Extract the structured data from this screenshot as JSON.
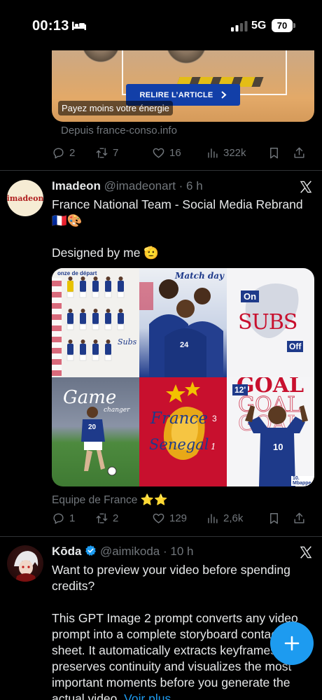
{
  "status_bar": {
    "time": "00:13",
    "network": "5G",
    "battery": "70"
  },
  "tweet_prev": {
    "ad_button": "RELIRE L’ARTICLE",
    "ad_caption": "Payez moins votre énergie",
    "source": "Depuis france-conso.info",
    "replies": "2",
    "reposts": "7",
    "likes": "16",
    "views": "322k"
  },
  "tweet1": {
    "avatar_text": "imadeon",
    "name": "Imadeon",
    "handle_time": "@imadeonart · 6 h",
    "line1": "France National Team - Social Media Rebrand",
    "emoji_line": "🇫🇷🎨",
    "line2": "Designed by me 🫡",
    "grid": {
      "c1_title": "onze de départ",
      "c1_label": "Subs",
      "c2_label": "Match day",
      "c2_number": "24",
      "c3_on": "On",
      "c3_title": "SUBS",
      "c3_off": "Off",
      "c4_title": "Game",
      "c4_sub": "changer",
      "c4_number": "20",
      "c5_title": "France",
      "c5_score1": "3",
      "c5_team2": "Senegal",
      "c5_score2": "1",
      "c6_title": "GOAL",
      "c6_number": "12'",
      "c6_shirt": "10",
      "c6_name": "10. Mbappe"
    },
    "footer_label": "Equipe de France ⭐⭐",
    "replies": "1",
    "reposts": "2",
    "likes": "129",
    "views": "2,6k"
  },
  "tweet2": {
    "name": "Kōda",
    "handle_time": "@aimikoda · 10 h",
    "para1": "Want to preview your video before spending credits?",
    "para2": "This GPT Image 2 prompt converts any video prompt into a complete storyboard contact sheet. It automatically extracts keyframes, preserves continuity and visualizes the most important moments before you generate the actual video.",
    "more_link": "Voir plus"
  },
  "colors": {
    "accent": "#1d9bf0",
    "muted": "#71767b",
    "france_blue": "#1e3a8a",
    "france_red": "#c8102e"
  },
  "icons": [
    "reply-icon",
    "repost-icon",
    "like-icon",
    "views-icon",
    "bookmark-icon",
    "share-icon",
    "x-logo-icon",
    "verified-icon",
    "compose-icon"
  ]
}
